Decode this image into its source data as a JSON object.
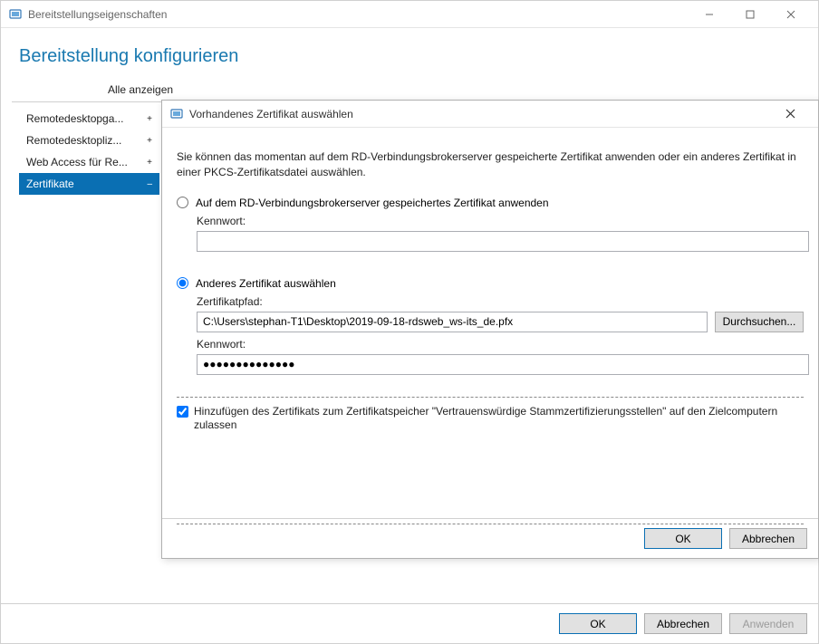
{
  "parent_window": {
    "title": "Bereitstellungseigenschaften",
    "heading": "Bereitstellung konfigurieren",
    "show_all": "Alle anzeigen"
  },
  "sidebar": {
    "items": [
      {
        "label": "Remotedesktopga...",
        "mark": "+"
      },
      {
        "label": "Remotedesktopliz...",
        "mark": "+"
      },
      {
        "label": "Web Access für Re...",
        "mark": "+"
      },
      {
        "label": "Zertifikate",
        "mark": "–"
      }
    ]
  },
  "parent_buttons": {
    "ok": "OK",
    "cancel": "Abbrechen",
    "apply": "Anwenden"
  },
  "modal": {
    "title": "Vorhandenes Zertifikat auswählen",
    "description": "Sie können das momentan auf dem RD-Verbindungsbrokerserver gespeicherte Zertifikat anwenden oder ein anderes Zertifikat in einer PKCS-Zertifikatsdatei auswählen.",
    "radio1_label": "Auf dem RD-Verbindungsbrokerserver gespeichertes Zertifikat anwenden",
    "password_label": "Kennwort:",
    "password1_value": "",
    "radio2_label": "Anderes Zertifikat auswählen",
    "cert_path_label": "Zertifikatpfad:",
    "cert_path_value": "C:\\Users\\stephan-T1\\Desktop\\2019-09-18-rdsweb_ws-its_de.pfx",
    "browse_label": "Durchsuchen...",
    "password2_value": "●●●●●●●●●●●●●●",
    "checkbox_label": "Hinzufügen des Zertifikats zum Zertifikatspeicher \"Vertrauenswürdige Stammzertifizierungsstellen\" auf den Zielcomputern zulassen",
    "ok": "OK",
    "cancel": "Abbrechen"
  }
}
